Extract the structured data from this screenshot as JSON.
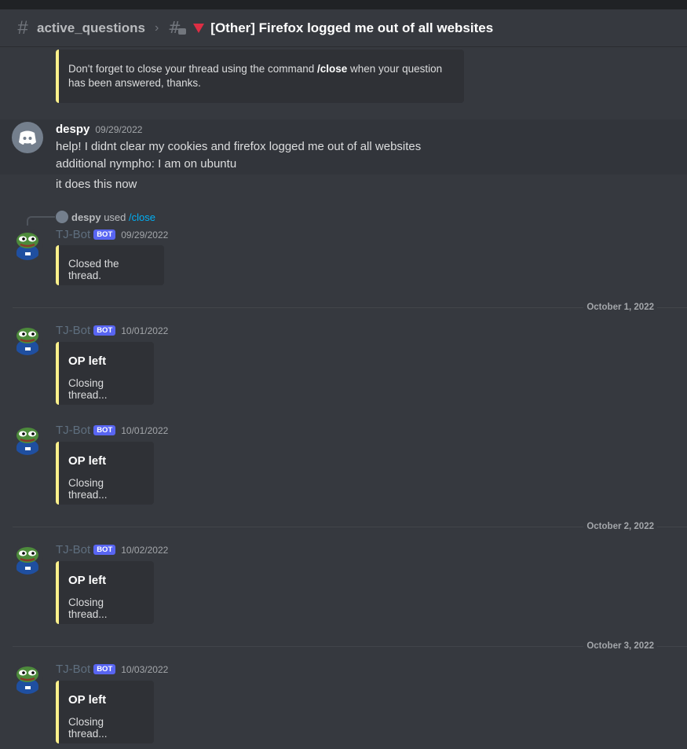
{
  "header": {
    "channel": "active_questions",
    "thread_title": "[Other] Firefox logged me out of all websites"
  },
  "first_embed": {
    "text_before": "Don't forget to close your thread using the command ",
    "command": "/close",
    "text_after": " when your question has been answered, thanks."
  },
  "despy_message": {
    "username": "despy",
    "timestamp": "09/29/2022",
    "lines": [
      "help! I didnt clear my cookies and firefox logged me out of all websites",
      "additional nympho: I am on ubuntu",
      "it does this now"
    ]
  },
  "reply": {
    "user": "despy",
    "action": "used",
    "command": "/close"
  },
  "bot": {
    "username": "TJ-Bot",
    "badge": "BOT"
  },
  "bot_messages": [
    {
      "timestamp": "09/29/2022",
      "embed_desc": "Closed the thread."
    },
    {
      "timestamp": "10/01/2022",
      "embed_title": "OP left",
      "embed_desc": "Closing thread..."
    },
    {
      "timestamp": "10/01/2022",
      "embed_title": "OP left",
      "embed_desc": "Closing thread..."
    },
    {
      "timestamp": "10/02/2022",
      "embed_title": "OP left",
      "embed_desc": "Closing thread..."
    },
    {
      "timestamp": "10/03/2022",
      "embed_title": "OP left",
      "embed_desc": "Closing thread..."
    }
  ],
  "date_dividers": [
    "October 1, 2022",
    "October 2, 2022",
    "October 3, 2022"
  ],
  "colors": {
    "background": "#36393f",
    "embed_accent": "#fdf18b",
    "bot_badge": "#5865f2",
    "link": "#00aff4"
  }
}
